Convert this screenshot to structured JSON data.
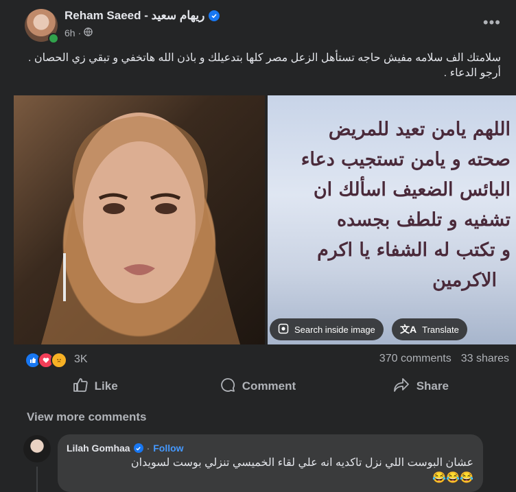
{
  "post": {
    "author": "Reham Saeed - ريهام سعيد",
    "time": "6h",
    "separator": "·",
    "text": "سلامتك الف سلامه مفيش حاجه تستأهل الزعل  مصر كلها بتدعيلك و باذن الله هاتخفي و تبقي زي الحصان . أرجو الدعاء .",
    "image_text_lines": [
      "اللهم يامن تعيد للمريض",
      "صحته و يامن تستجيب دعاء",
      "البائس الضعيف اسألك ان",
      "تشفيه و تلطف بجسده",
      "و تكتب له الشفاء يا اكرم",
      "الاكرمين"
    ],
    "search_inside_image": "Search inside image",
    "translate": "Translate"
  },
  "stats": {
    "reactions_count": "3K",
    "comments": "370 comments",
    "shares": "33 shares"
  },
  "actions": {
    "like": "Like",
    "comment": "Comment",
    "share": "Share"
  },
  "view_more_comments": "View more comments",
  "comment": {
    "author": "Lilah Gomhaa",
    "separator": "·",
    "follow": "Follow",
    "text": "عشان البوست اللي نزل تاكديه انه علي لقاء الخميسي تنزلي بوست لسويدان",
    "emojis": "😂😂😂"
  },
  "colors": {
    "background": "#242526",
    "accent": "#1877f2",
    "link": "#4599ff"
  }
}
